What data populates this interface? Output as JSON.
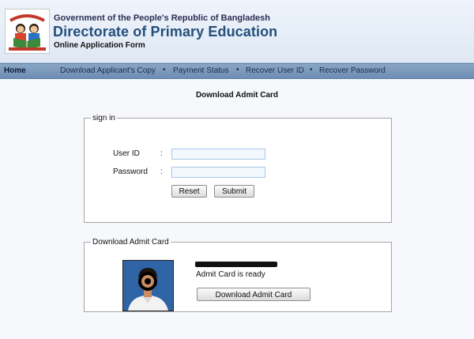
{
  "header": {
    "org_line": "Government of the People's Republic of Bangladesh",
    "title": "Directorate of Primary Education",
    "subtitle": "Online Application Form"
  },
  "nav": {
    "home": "Home",
    "items": [
      "Download Applicant's Copy",
      "Payment Status",
      "Recover User ID",
      "Recover Password"
    ],
    "separator": "•"
  },
  "page_title": "Download Admit Card",
  "signin": {
    "legend": "sign in",
    "user_id_label": "User ID",
    "password_label": "Password",
    "colon": ":",
    "user_id_value": "",
    "password_value": "",
    "reset_label": "Reset",
    "submit_label": "Submit"
  },
  "admit": {
    "legend": "Download Admit Card",
    "status_text": "Admit Card is ready",
    "download_label": "Download Admit Card"
  },
  "colors": {
    "title_blue": "#244f7d",
    "nav_bar": "#7b97bb",
    "input_border": "#a9c6e6"
  }
}
